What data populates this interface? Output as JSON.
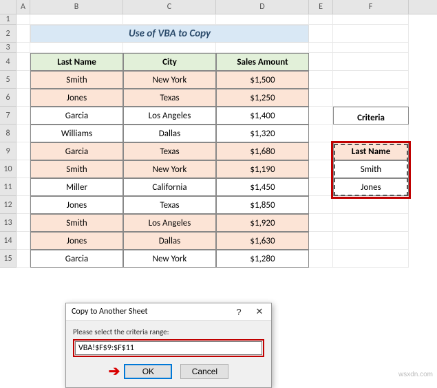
{
  "columns": [
    "A",
    "B",
    "C",
    "D",
    "E",
    "F"
  ],
  "rows": [
    "1",
    "2",
    "3",
    "4",
    "5",
    "6",
    "7",
    "8",
    "9",
    "10",
    "11",
    "12",
    "13",
    "14",
    "15"
  ],
  "title": "Use of VBA to Copy",
  "table": {
    "headers": [
      "Last Name",
      "City",
      "Sales Amount"
    ],
    "data": [
      [
        "Smith",
        "New York",
        "$1,500"
      ],
      [
        "Jones",
        "Texas",
        "$1,250"
      ],
      [
        "Garcia",
        "Los Angeles",
        "$1,400"
      ],
      [
        "Williams",
        "Dallas",
        "$1,320"
      ],
      [
        "Garcia",
        "Texas",
        "$1,680"
      ],
      [
        "Smith",
        "New York",
        "$1,190"
      ],
      [
        "Miller",
        "California",
        "$1,450"
      ],
      [
        "Jones",
        "Texas",
        "$1,850"
      ],
      [
        "Smith",
        "Los Angeles",
        "$1,920"
      ],
      [
        "Jones",
        "Dallas",
        "$1,630"
      ],
      [
        "Garcia",
        "New York",
        "$1,280"
      ]
    ]
  },
  "criteria": {
    "label": "Criteria",
    "header": "Last Name",
    "values": [
      "Smith",
      "Jones"
    ]
  },
  "dialog": {
    "title": "Copy to Another Sheet",
    "help": "?",
    "close": "✕",
    "prompt": "Please select the criteria range:",
    "input": "VBA!$F$9:$F$11",
    "ok": "OK",
    "cancel": "Cancel"
  },
  "watermark": "wsxdn.com",
  "chart_data": {
    "type": "table",
    "title": "Use of VBA to Copy",
    "headers": [
      "Last Name",
      "City",
      "Sales Amount"
    ],
    "rows": [
      [
        "Smith",
        "New York",
        1500
      ],
      [
        "Jones",
        "Texas",
        1250
      ],
      [
        "Garcia",
        "Los Angeles",
        1400
      ],
      [
        "Williams",
        "Dallas",
        1320
      ],
      [
        "Garcia",
        "Texas",
        1680
      ],
      [
        "Smith",
        "New York",
        1190
      ],
      [
        "Miller",
        "California",
        1450
      ],
      [
        "Jones",
        "Texas",
        1850
      ],
      [
        "Smith",
        "Los Angeles",
        1920
      ],
      [
        "Jones",
        "Dallas",
        1630
      ],
      [
        "Garcia",
        "New York",
        1280
      ]
    ]
  }
}
